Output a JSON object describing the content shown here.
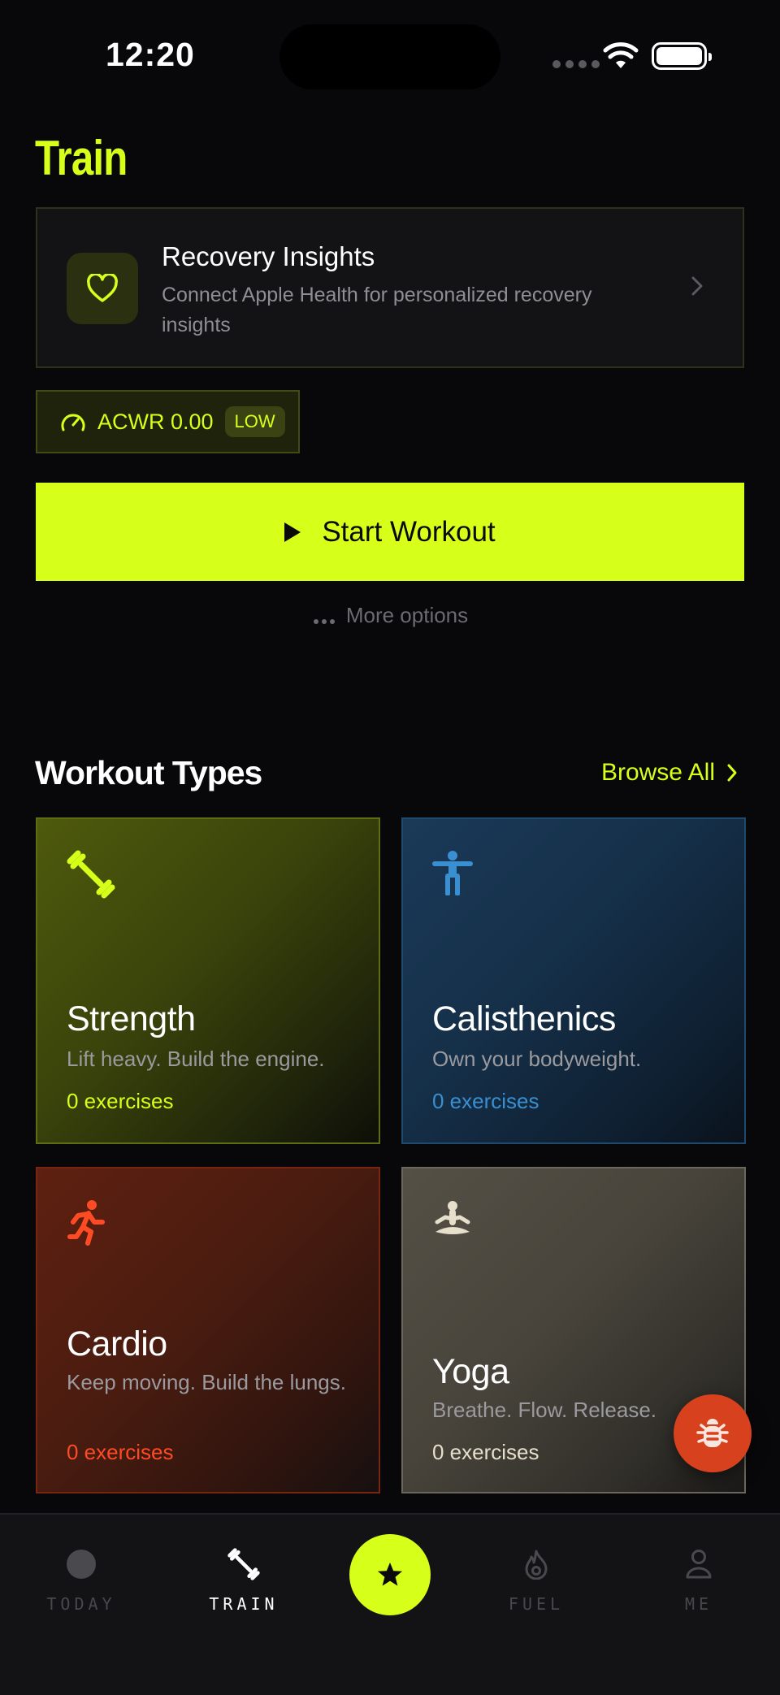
{
  "status_bar": {
    "time": "12:20"
  },
  "header": {
    "title": "Train"
  },
  "recovery": {
    "title": "Recovery Insights",
    "description": "Connect Apple Health for personalized recovery insights"
  },
  "acwr": {
    "label": "ACWR 0.00",
    "badge": "LOW"
  },
  "actions": {
    "start_workout": "Start Workout",
    "more_options": "More options"
  },
  "workout_types": {
    "title": "Workout Types",
    "browse_all": "Browse All",
    "cards": [
      {
        "name": "Strength",
        "description": "Lift heavy. Build the engine.",
        "count": "0 exercises",
        "accent": "#d6ff1a",
        "icon": "dumbbell-icon"
      },
      {
        "name": "Calisthenics",
        "description": "Own your bodyweight.",
        "count": "0 exercises",
        "accent": "#3a8fd1",
        "icon": "person-standing-icon"
      },
      {
        "name": "Cardio",
        "description": "Keep moving. Build the lungs.",
        "count": "0 exercises",
        "accent": "#ff4b23",
        "icon": "running-icon"
      },
      {
        "name": "Yoga",
        "description": "Breathe. Flow. Release.",
        "count": "0 exercises",
        "accent": "#e6dfcc",
        "icon": "meditation-icon"
      }
    ]
  },
  "tab_bar": {
    "items": [
      {
        "label": "TODAY",
        "icon": "today-icon",
        "active": false
      },
      {
        "label": "TRAIN",
        "icon": "dumbbell-icon",
        "active": true
      },
      {
        "label": "",
        "icon": "star-icon",
        "active": false
      },
      {
        "label": "FUEL",
        "icon": "flame-icon",
        "active": false
      },
      {
        "label": "ME",
        "icon": "person-icon",
        "active": false
      }
    ]
  },
  "colors": {
    "accent": "#d6ff1a",
    "background": "#08080a",
    "bug_fab": "#d8411d"
  }
}
